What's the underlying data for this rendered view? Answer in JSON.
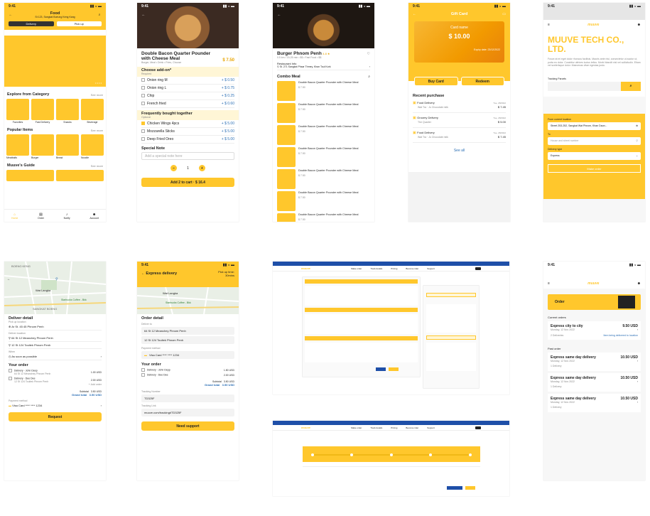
{
  "food": {
    "time": "9:41",
    "title": "Food",
    "address": "St 123, Sangkat Boeung Keng Kang",
    "tab_delivery": "Delivery",
    "tab_pickup": "Pick up",
    "explore": "Explore from Category",
    "see_more": "See more",
    "categories": [
      "Favorites",
      "Fast Delivery",
      "Snacks",
      "Beverage"
    ],
    "popular": "Popular Items",
    "popular_items": [
      "Meatballs",
      "Burger",
      "Bread",
      "Noodle"
    ],
    "guide": "Muuve's Guide",
    "nav": [
      "Home",
      "Order",
      "Notify",
      "Account"
    ]
  },
  "product": {
    "time": "9:41",
    "title": "Double Bacon Quarter Pounder with Cheese Meal",
    "desc": "Burger, Meal • Drink • Fries, Choose",
    "price": "$ 7.50",
    "addon_title": "Choose add-on*",
    "addon_req": "Required",
    "addons": [
      {
        "name": "Onion ring M",
        "price": "+ $ 0.50"
      },
      {
        "name": "Onion ring L",
        "price": "+ $ 0.75"
      },
      {
        "name": "Chip",
        "price": "+ $ 0.25"
      },
      {
        "name": "French fried",
        "price": "+ $ 0.60"
      }
    ],
    "fbt_title": "Frequently bought together",
    "fbt_sub": "Optional",
    "fbt": [
      {
        "name": "Chicken Wings 4pcs",
        "price": "+ $ 5.00"
      },
      {
        "name": "Mozzarella Sticks",
        "price": "+ $ 5.00"
      },
      {
        "name": "Deep Fried Oreo",
        "price": "+ $ 5.00"
      }
    ],
    "note_label": "Special Note",
    "note_placeholder": "Add a special note here",
    "qty": "1",
    "add_cart": "Add 2 to cart · $ 16.4"
  },
  "restaurant": {
    "time": "9:41",
    "name": "Burger Phnom Penh",
    "rating": "4.8 ★",
    "meta": "0.5 km • 15-25 min • $$ • Fast Food • $$",
    "info_label": "Restaurant Info",
    "address": "St. 271 Sangkat Phsar Thmey, Khan Toul Kork",
    "menu_title": "Combo Meal",
    "items": [
      {
        "name": "Double Bacon Quarter Pounder with Cheese Meal",
        "price": "$ 7.50"
      },
      {
        "name": "Double Bacon Quarter Pounder with Cheese Meal",
        "price": "$ 7.50"
      },
      {
        "name": "Double Bacon Quarter Pounder with Cheese Meal",
        "price": "$ 7.50"
      },
      {
        "name": "Double Bacon Quarter Pounder with Cheese Meal",
        "price": "$ 7.50"
      },
      {
        "name": "Double Bacon Quarter Pounder with Cheese Meal",
        "price": "$ 7.50"
      },
      {
        "name": "Double Bacon Quarter Pounder with Cheese Meal",
        "price": "$ 7.50"
      },
      {
        "name": "Double Bacon Quarter Pounder with Cheese Meal",
        "price": "$ 7.50"
      },
      {
        "name": "Double Bacon Quarter Pounder with Cheese Meal",
        "price": "$ 7.50"
      }
    ]
  },
  "gift": {
    "time": "9:41",
    "title": "Gift Card",
    "card_name": "Card name",
    "amount": "$ 10.00",
    "expiry": "Expiry date: 23/12/2022",
    "buy": "Buy Card",
    "redeem": "Redeem",
    "recent": "Recent purchase",
    "purchases": [
      {
        "name": "Food Delivery",
        "place": "Wat Tra · Jo Chocolate milk",
        "date": "Tue, 28/2022",
        "price": "$ 7.45"
      },
      {
        "name": "Grocery Delivery",
        "place": "The Quarter",
        "date": "Tue, 28/2022",
        "price": "$ 5.00"
      },
      {
        "name": "Food Delivery",
        "place": "Wat Tra · Jo Chocolate milk",
        "date": "Tue, 28/2022",
        "price": "$ 7.45"
      }
    ],
    "see_all": "See all"
  },
  "web_home": {
    "time": "9:41",
    "brand": "muuve",
    "headline": "MUUVE TECH CO., LTD.",
    "body": "Fusce at mi eget dolor rhoncus facilisis. Mauris ante nisi, consectetur ut auctor ut, porta eu dolor. Curabitur ultrices luctus tellus. Morbi blandit nisl vel sollicitudin. Etiam vel scelerisque dolor. Maecenas vitae egestas justo.",
    "tracking_label": "Tracking Parcels",
    "from_label": "From current location",
    "from_value": "Street 253-252, Sangkat Wat Phnom, Khan Daun...",
    "to_label": "To",
    "to_placeholder": "House and street number",
    "type_label": "Delivery type",
    "type_value": "Express",
    "btn": "Make order"
  },
  "map": {
    "labels": [
      "BOENG KENG",
      "Wat Langka",
      "Starbucks Coffee - Bkk",
      "SANGKAT BOENG"
    ],
    "deliver_detail": "Deliver detail",
    "pickup_label": "Pick up location",
    "pickup": "Ar St. 45 45 Phnom Penh",
    "deliver_label": "Deliver location",
    "locs": [
      "64 St 12 Meanchey Phnom Penh",
      "12 St 124 Toultek Phnom Penh"
    ],
    "when": "When",
    "when_value": "As soon as possible",
    "your_order": "Your order",
    "orders": [
      {
        "name": "Delivery · John Deep",
        "sub": "64 St 12 Meanchey Phnom Penh",
        "price": "1.00 USD"
      },
      {
        "name": "Delivery · Dee Dee",
        "sub": "12 St 124 Toultek Phnom Penh",
        "price": "2.00 USD"
      }
    ],
    "order_note": "+ Add order",
    "subtotal_label": "Subtotal",
    "subtotal": "3.50 USD",
    "total_label": "Grand total",
    "total": "3.50 USD",
    "payment_label": "Payment method",
    "card": "Visa Card **** **** 1234",
    "btn": "Request"
  },
  "express": {
    "time": "9:41",
    "title": "Express delivery",
    "pickup_time": "Pick up time:",
    "pickup_value": "30mins",
    "order_detail": "Order detail",
    "deliver_to": "Deliver to",
    "addr1": "64 St 12 Meanchey Phnom Penh",
    "addr2": "12 St 124 Toultek Phnom Penh",
    "payment_label": "Payment method",
    "card": "Visa Card **** **** 1234",
    "your_order": "Your order",
    "items": [
      {
        "name": "Delivery - John Depp",
        "price": "1.50 USD"
      },
      {
        "name": "Delivery - Dee Dee",
        "price": "2.00 USD"
      }
    ],
    "subtotal_label": "Subtotal",
    "subtotal": "3.50 USD",
    "total_label": "Grand total",
    "total": "3.50 USD",
    "tracking_label": "Tracking Number",
    "tracking": "TD325F",
    "link_label": "Tracking Link",
    "link": "muuve.com/tracking#TD325F",
    "btn": "Need support"
  },
  "web_order": {
    "brand": "muuve",
    "nav": [
      "Make order",
      "Track details",
      "Pricing",
      "Become rider",
      "Support"
    ]
  },
  "orders": {
    "time": "9:41",
    "brand": "muuve",
    "title": "Order",
    "current": "Current orders",
    "orders": [
      {
        "name": "Express city to city",
        "date": "Monday, 12 Nov 2022",
        "price": "9.50 USD",
        "status": "2 Deliveries",
        "link": "Item being delivered to location"
      }
    ],
    "past": "Past order",
    "past_orders": [
      {
        "name": "Express same day delivery",
        "date": "Monday, 12 Nov 2022",
        "price": "10.50 USD",
        "status": "1 Delivery"
      },
      {
        "name": "Express same day delivery",
        "date": "Monday, 12 Nov 2022",
        "price": "10.50 USD",
        "status": "1 Delivery"
      },
      {
        "name": "Express same day delivery",
        "date": "Monday, 12 Nov 2022",
        "price": "10.50 USD",
        "status": "1 Delivery"
      }
    ]
  }
}
